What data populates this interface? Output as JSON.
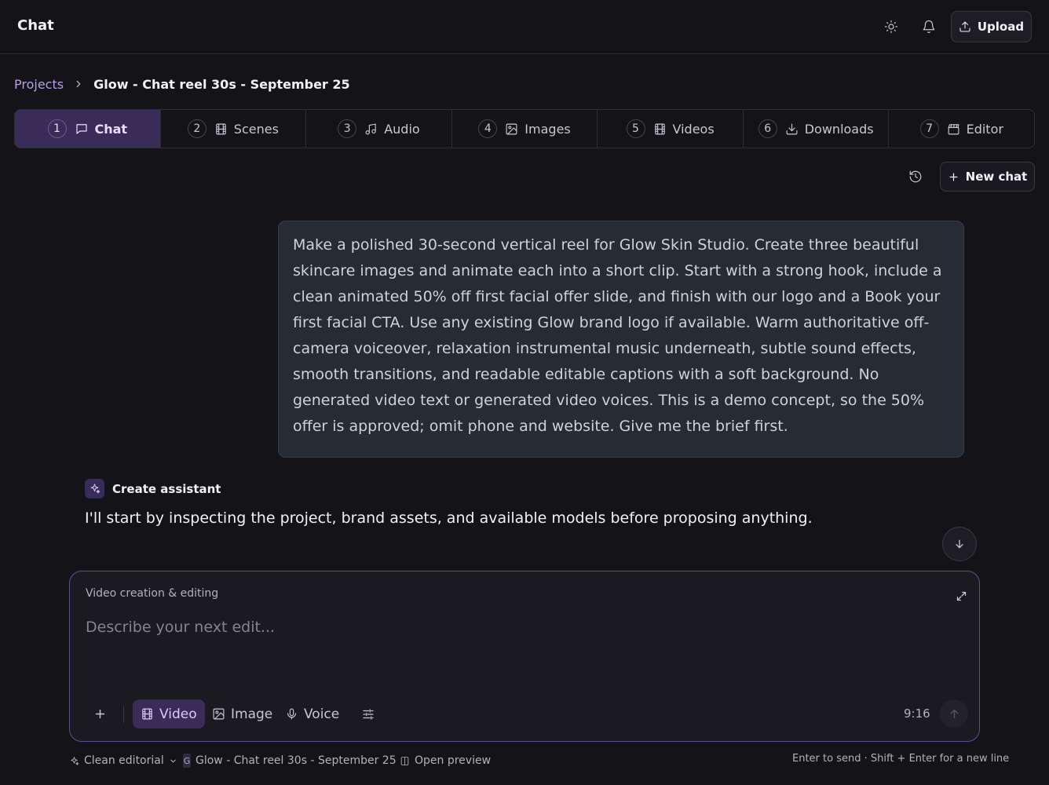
{
  "app": {
    "title": "Chat"
  },
  "header": {
    "upload_label": "Upload"
  },
  "breadcrumb": {
    "root": "Projects",
    "current": "Glow - Chat reel 30s - September 25"
  },
  "steps": [
    {
      "num": "1",
      "label": "Chat",
      "icon": "chat-bubble-icon",
      "active": true
    },
    {
      "num": "2",
      "label": "Scenes",
      "icon": "film-icon"
    },
    {
      "num": "3",
      "label": "Audio",
      "icon": "music-note-icon"
    },
    {
      "num": "4",
      "label": "Images",
      "icon": "image-icon"
    },
    {
      "num": "5",
      "label": "Videos",
      "icon": "film-icon"
    },
    {
      "num": "6",
      "label": "Downloads",
      "icon": "download-icon"
    },
    {
      "num": "7",
      "label": "Editor",
      "icon": "clapperboard-icon"
    }
  ],
  "chat": {
    "new_chat_label": "New chat",
    "user_message": "Make a polished 30-second vertical reel for Glow Skin Studio. Create three beautiful skincare images and animate each into a short clip. Start with a strong hook, include a clean animated 50% off first facial offer slide, and finish with our logo and a Book your first facial CTA. Use any existing Glow brand logo if available. Warm authoritative off-camera voiceover, relaxation instrumental music underneath, subtle sound effects, smooth transitions, and readable editable captions with a soft background. No generated video text or generated video voices. This is a demo concept, so the 50% offer is approved; omit phone and website. Give me the brief first.",
    "assistant_name": "Create assistant",
    "assistant_message": "I'll start by inspecting the project, brand assets, and available models before proposing anything."
  },
  "composer": {
    "mode_label": "Video creation & editing",
    "placeholder": "Describe your next edit...",
    "modes": {
      "video": "Video",
      "image": "Image",
      "voice": "Voice"
    },
    "active_mode": "Video",
    "aspect_ratio": "9:16"
  },
  "footer": {
    "style": "Clean editorial",
    "brand_initial": "G",
    "project": "Glow - Chat reel 30s - September 25",
    "preview": "Open preview",
    "hint": "Enter to send · Shift + Enter for a new line"
  },
  "colors": {
    "accent": "#3a2c59",
    "accent_text": "#b7a2ea",
    "background": "#141318",
    "composer_border": "#5a5090"
  }
}
